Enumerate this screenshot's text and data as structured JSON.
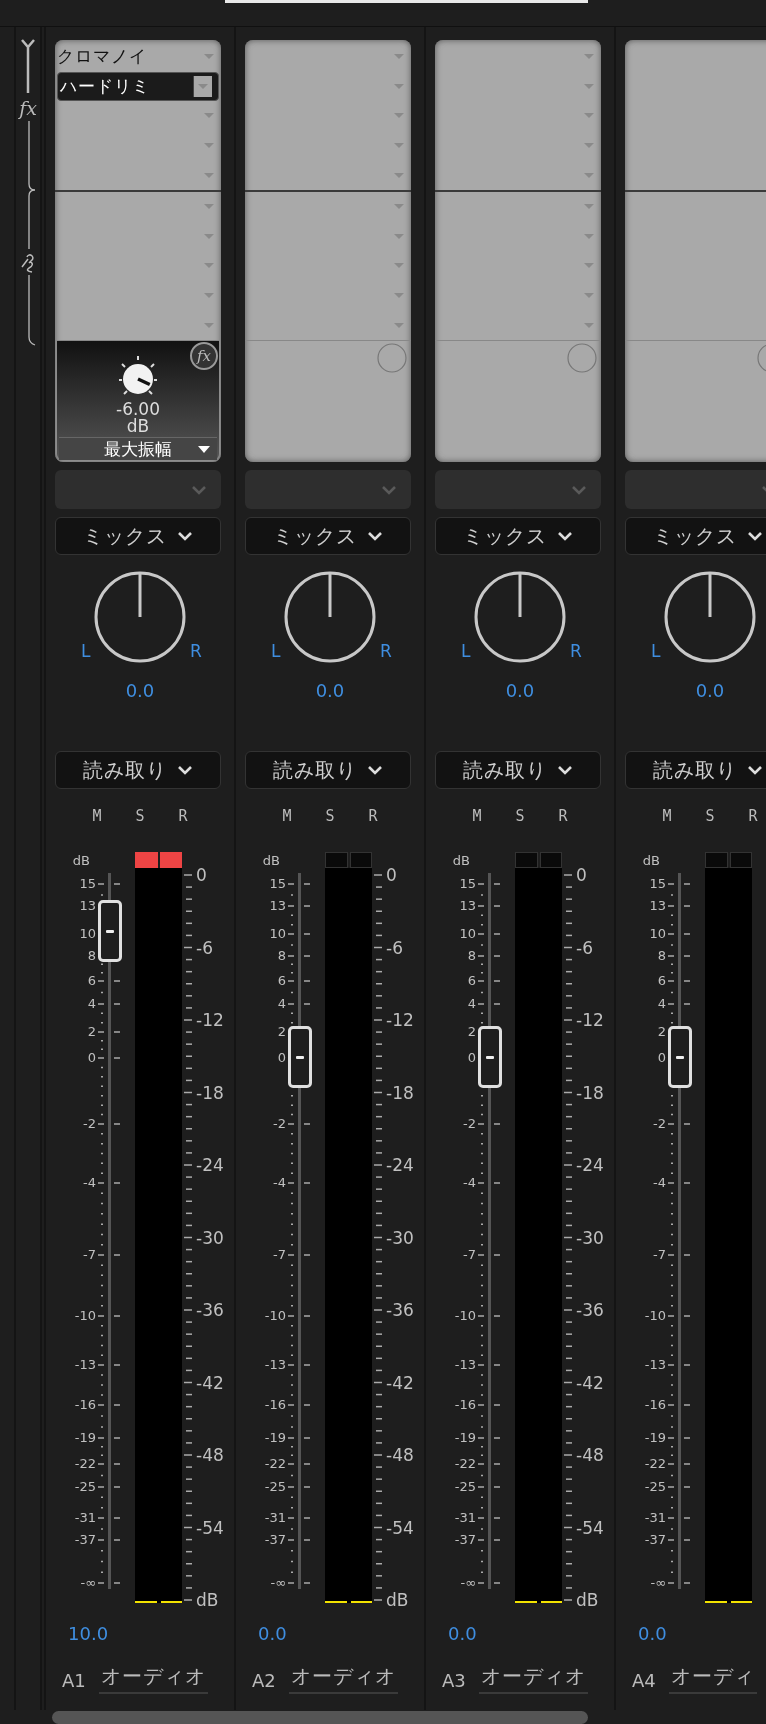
{
  "rack": {
    "effects_label": "fx"
  },
  "channels": [
    {
      "effects": [
        {
          "name": "クロマノイ",
          "selected": false
        },
        {
          "name": "ハードリミ",
          "selected": true
        }
      ],
      "send": {
        "value": "-6.00",
        "unit": "dB",
        "param": "最大振幅",
        "bypass_label": "fx"
      },
      "mode": "ミックス",
      "pan": {
        "left": "L",
        "right": "R",
        "value": "0.0"
      },
      "automation": "読み取り",
      "buttons": [
        {
          "label": "M",
          "on": false
        },
        {
          "label": "S",
          "on": false
        },
        {
          "label": "R",
          "on": false
        }
      ],
      "fader_unit": "dB",
      "fader_scale": [
        "15",
        "13",
        "10",
        "8",
        "6",
        "4",
        "2",
        "0",
        "-2",
        "-4",
        "-7",
        "-10",
        "-13",
        "-16",
        "-19",
        "-22",
        "-25",
        "-31",
        "-37",
        "-∞"
      ],
      "meter": {
        "clipped": true,
        "level": 0
      },
      "meter_scale": [
        "0",
        "-6",
        "-12",
        "-18",
        "-24",
        "-30",
        "-36",
        "-42",
        "-48",
        "-54",
        "dB"
      ],
      "volume": "10.0",
      "track_id": "A1",
      "track_name": "オーディオ"
    },
    {
      "mode": "ミックス",
      "pan": {
        "left": "L",
        "right": "R",
        "value": "0.0"
      },
      "automation": "読み取り",
      "buttons": [
        {
          "label": "M",
          "on": false
        },
        {
          "label": "S",
          "on": false
        },
        {
          "label": "R",
          "on": false
        }
      ],
      "fader_unit": "dB",
      "fader_scale": [
        "15",
        "13",
        "10",
        "8",
        "6",
        "4",
        "2",
        "0",
        "-2",
        "-4",
        "-7",
        "-10",
        "-13",
        "-16",
        "-19",
        "-22",
        "-25",
        "-31",
        "-37",
        "-∞"
      ],
      "meter": {
        "clipped": false,
        "level": 0
      },
      "meter_scale": [
        "0",
        "-6",
        "-12",
        "-18",
        "-24",
        "-30",
        "-36",
        "-42",
        "-48",
        "-54",
        "dB"
      ],
      "volume": "0.0",
      "track_id": "A2",
      "track_name": "オーディオ"
    },
    {
      "mode": "ミックス",
      "pan": {
        "left": "L",
        "right": "R",
        "value": "0.0"
      },
      "automation": "読み取り",
      "buttons": [
        {
          "label": "M",
          "on": false
        },
        {
          "label": "S",
          "on": false
        },
        {
          "label": "R",
          "on": false
        }
      ],
      "fader_unit": "dB",
      "fader_scale": [
        "15",
        "13",
        "10",
        "8",
        "6",
        "4",
        "2",
        "0",
        "-2",
        "-4",
        "-7",
        "-10",
        "-13",
        "-16",
        "-19",
        "-22",
        "-25",
        "-31",
        "-37",
        "-∞"
      ],
      "meter": {
        "clipped": false,
        "level": 0
      },
      "meter_scale": [
        "0",
        "-6",
        "-12",
        "-18",
        "-24",
        "-30",
        "-36",
        "-42",
        "-48",
        "-54",
        "dB"
      ],
      "volume": "0.0",
      "track_id": "A3",
      "track_name": "オーディオ"
    },
    {
      "mode": "ミックス",
      "pan": {
        "left": "L",
        "value": "0.0"
      },
      "automation": "読み取り",
      "buttons": [
        {
          "label": "M",
          "on": false
        },
        {
          "label": "S",
          "on": false
        },
        {
          "label": "R",
          "on": false
        }
      ],
      "fader_unit": "dB",
      "fader_scale": [
        "15",
        "13",
        "10",
        "8",
        "6",
        "4",
        "2",
        "0",
        "-2",
        "-4",
        "-7",
        "-10",
        "-13",
        "-16",
        "-19",
        "-22",
        "-25",
        "-31",
        "-37",
        "-∞"
      ],
      "meter": {
        "clipped": false,
        "level": 0
      },
      "volume": "0.0",
      "track_id": "A4",
      "track_name": "オーディ"
    }
  ]
}
